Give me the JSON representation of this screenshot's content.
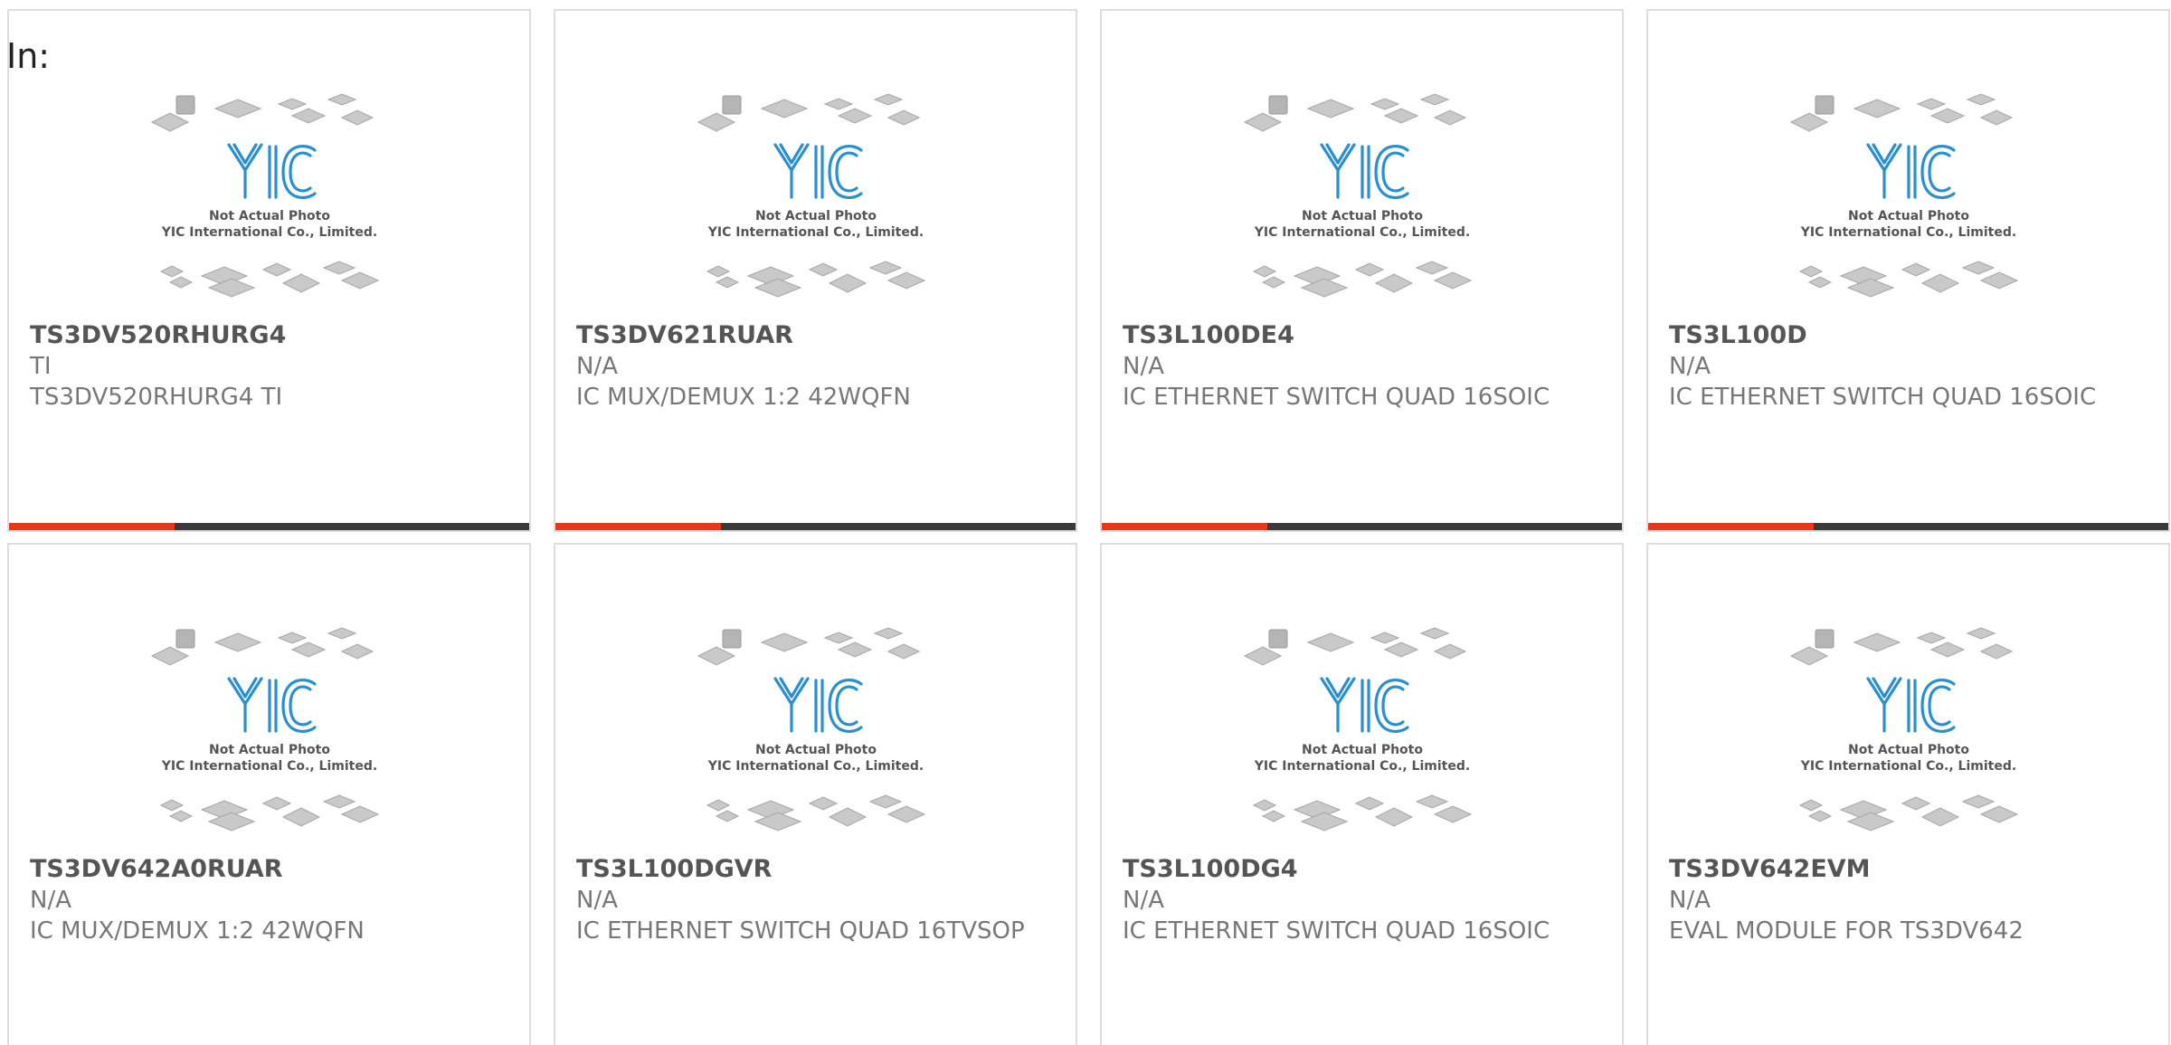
{
  "page": {
    "in_label": "In:"
  },
  "placeholder_image": {
    "logo_text": "YIC",
    "caption_line1": "Not Actual Photo",
    "caption_line2": "YIC International Co., Limited."
  },
  "colors": {
    "accent": "#e8381a",
    "bar": "#3a3a3a",
    "logo": "#2a8fd0",
    "text": "#777777"
  },
  "products": [
    {
      "part_number": "TS3DV520RHURG4",
      "manufacturer": "TI",
      "description": "TS3DV520RHURG4 TI"
    },
    {
      "part_number": "TS3DV621RUAR",
      "manufacturer": "N/A",
      "description": "IC MUX/DEMUX 1:2 42WQFN"
    },
    {
      "part_number": "TS3L100DE4",
      "manufacturer": "N/A",
      "description": "IC ETHERNET SWITCH QUAD 16SOIC"
    },
    {
      "part_number": "TS3L100D",
      "manufacturer": "N/A",
      "description": "IC ETHERNET SWITCH QUAD 16SOIC"
    },
    {
      "part_number": "TS3DV642A0RUAR",
      "manufacturer": "N/A",
      "description": "IC MUX/DEMUX 1:2 42WQFN"
    },
    {
      "part_number": "TS3L100DGVR",
      "manufacturer": "N/A",
      "description": "IC ETHERNET SWITCH QUAD 16TVSOP"
    },
    {
      "part_number": "TS3L100DG4",
      "manufacturer": "N/A",
      "description": "IC ETHERNET SWITCH QUAD 16SOIC"
    },
    {
      "part_number": "TS3DV642EVM",
      "manufacturer": "N/A",
      "description": "EVAL MODULE FOR TS3DV642"
    }
  ]
}
